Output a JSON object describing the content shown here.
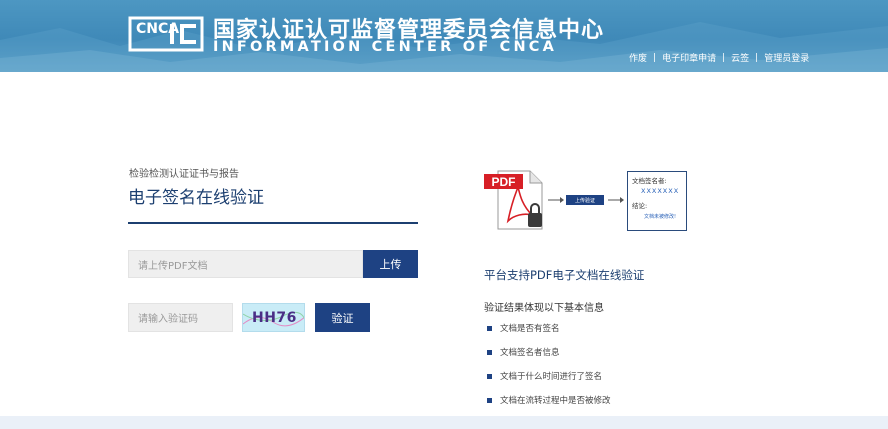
{
  "header": {
    "title_cn": "国家认证认可监督管理委员会信息中心",
    "title_en": "INFORMATION CENTER OF CNCA",
    "logo_text": "CNCA",
    "nav": [
      "作废",
      "电子印章申请",
      "云签",
      "管理员登录"
    ]
  },
  "verify": {
    "subtitle": "检验检测认证证书与报告",
    "title": "电子签名在线验证",
    "upload_placeholder": "请上传PDF文档",
    "upload_button": "上传",
    "captcha_placeholder": "请输入验证码",
    "captcha_text": "HH76",
    "verify_button": "验证"
  },
  "diagram": {
    "pdf_label": "PDF",
    "step_button": "上传验证",
    "card": {
      "signer_label": "文档签名者:",
      "signer_value": "XXXXXXX",
      "conclusion_label": "结论:",
      "conclusion_value": "文档未被修改!"
    }
  },
  "info": {
    "heading": "平台支持PDF电子文档在线验证",
    "label": "验证结果体现以下基本信息",
    "items": [
      "文档是否有签名",
      "文档签名者信息",
      "文档于什么时间进行了签名",
      "文档在流转过程中是否被修改"
    ]
  },
  "colors": {
    "primary": "#1e4283",
    "banner": "#4d97c2",
    "title": "#1c3f70",
    "pdf_red": "#d71f26"
  }
}
